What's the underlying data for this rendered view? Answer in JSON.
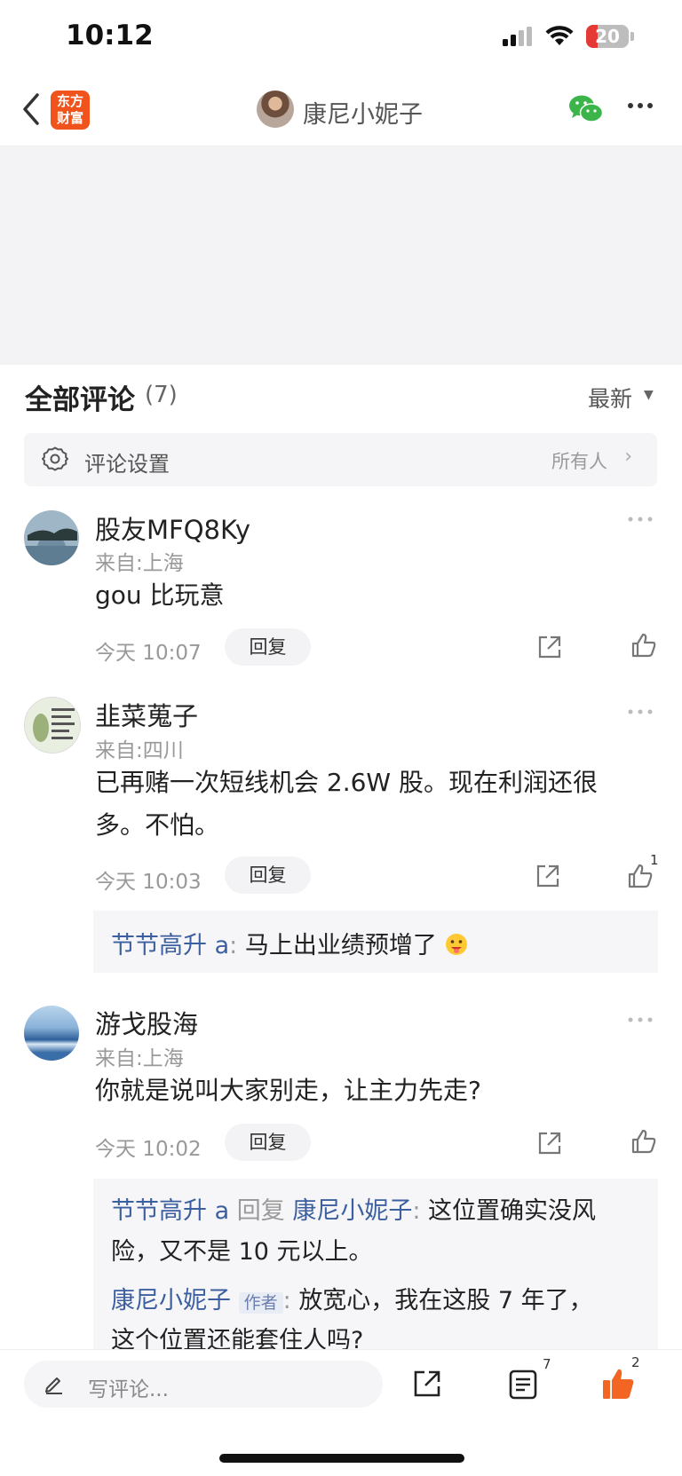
{
  "status": {
    "time": "10:12",
    "battery": "20"
  },
  "nav": {
    "logo_line1": "东方",
    "logo_line2": "财富",
    "title": "康尼小妮子"
  },
  "comments_header": {
    "title": "全部评论",
    "count": "(7)",
    "sort": "最新"
  },
  "settings": {
    "label": "评论设置",
    "value": "所有人"
  },
  "comments": [
    {
      "user": "股友MFQ8Ky",
      "location": "来自:上海",
      "text": "gou 比玩意",
      "time": "今天 10:07",
      "reply": "回复",
      "likes": ""
    },
    {
      "user": "韭菜蒐子",
      "location": "来自:四川",
      "text_line1": "已再赌一次短线机会 2.6W 股。现在利润还很",
      "text_line2": "多。不怕。",
      "time": "今天 10:03",
      "reply": "回复",
      "likes": "1",
      "subreply": {
        "user": "节节高升 a",
        "sep": ":",
        "text": "马上出业绩预增了"
      }
    },
    {
      "user": "游戈股海",
      "location": "来自:上海",
      "text": "你就是说叫大家别走，让主力先走?",
      "time": "今天 10:02",
      "reply": "回复",
      "likes": "",
      "subreplies": [
        {
          "user": "节节高升 a",
          "reply_word": "回复",
          "target": "康尼小妮子",
          "sep": ":",
          "text_line1": "这位置确实没风",
          "text_line2": "险，又不是 10 元以上。"
        },
        {
          "user": "康尼小妮子",
          "tag": "作者",
          "sep": ":",
          "text_line1": "放宽心，我在这股 7 年了，",
          "text_line2": "这个位置还能套住人吗?"
        }
      ]
    }
  ],
  "bottom": {
    "placeholder": "写评论...",
    "comment_count": "7",
    "like_count": "2"
  }
}
